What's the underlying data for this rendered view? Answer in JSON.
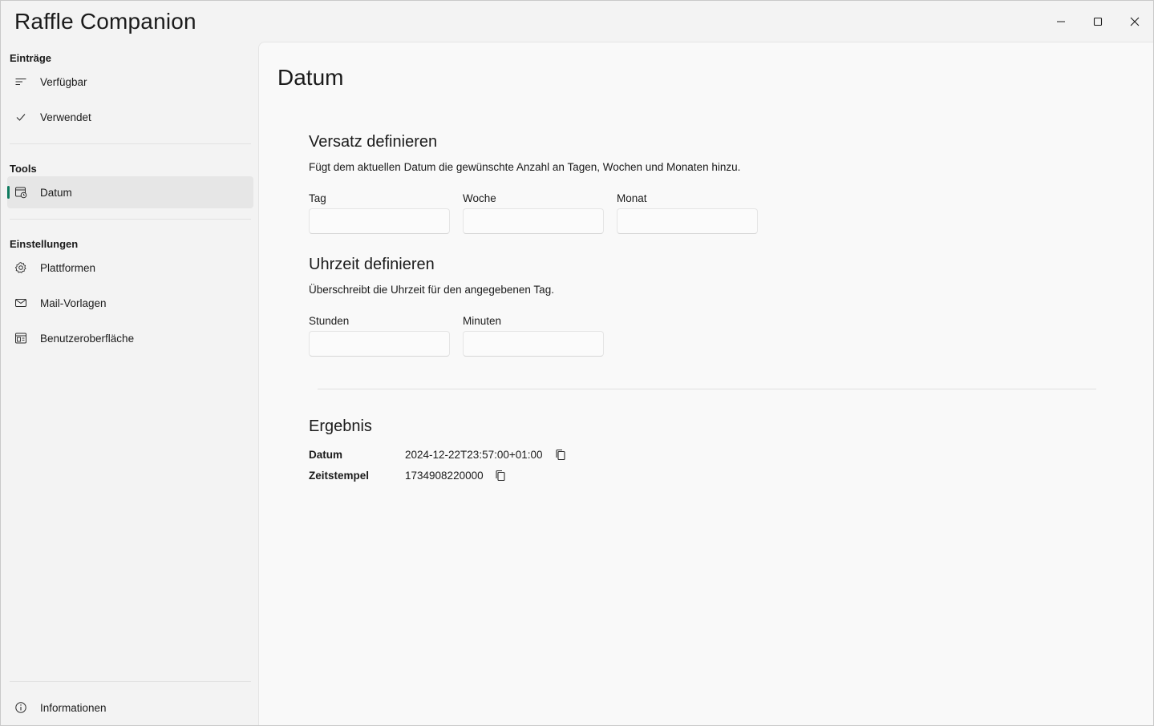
{
  "window": {
    "title": "Raffle Companion",
    "controls": [
      "minimize-icon",
      "maximize-icon",
      "close-icon"
    ]
  },
  "sidebar": {
    "sections": [
      {
        "header": "Einträge",
        "items": [
          {
            "label": "Verfügbar",
            "icon": "list-lines-icon"
          },
          {
            "label": "Verwendet",
            "icon": "checkmark-icon"
          }
        ]
      },
      {
        "header": "Tools",
        "items": [
          {
            "label": "Datum",
            "icon": "calendar-clock-icon",
            "active": true
          }
        ]
      },
      {
        "header": "Einstellungen",
        "items": [
          {
            "label": "Plattformen",
            "icon": "gear-icon"
          },
          {
            "label": "Mail-Vorlagen",
            "icon": "mail-icon"
          },
          {
            "label": "Benutzeroberfläche",
            "icon": "window-layout-icon"
          }
        ]
      }
    ],
    "footer": {
      "label": "Informationen",
      "icon": "info-icon"
    }
  },
  "page": {
    "title": "Datum",
    "offset": {
      "title": "Versatz definieren",
      "description": "Fügt dem aktuellen Datum die gewünschte Anzahl an Tagen, Wochen und Monaten hinzu.",
      "fields": [
        {
          "label": "Tag",
          "value": ""
        },
        {
          "label": "Woche",
          "value": ""
        },
        {
          "label": "Monat",
          "value": ""
        }
      ]
    },
    "time": {
      "title": "Uhrzeit definieren",
      "description": "Überschreibt die Uhrzeit für den angegebenen Tag.",
      "fields": [
        {
          "label": "Stunden",
          "value": ""
        },
        {
          "label": "Minuten",
          "value": ""
        }
      ]
    },
    "result": {
      "title": "Ergebnis",
      "rows": [
        {
          "key": "Datum",
          "value": "2024-12-22T23:57:00+01:00"
        },
        {
          "key": "Zeitstempel",
          "value": "1734908220000"
        }
      ]
    }
  },
  "colors": {
    "accent": "#0f7b5f",
    "background": "#f3f3f3",
    "content_background": "#f9f9f9"
  }
}
